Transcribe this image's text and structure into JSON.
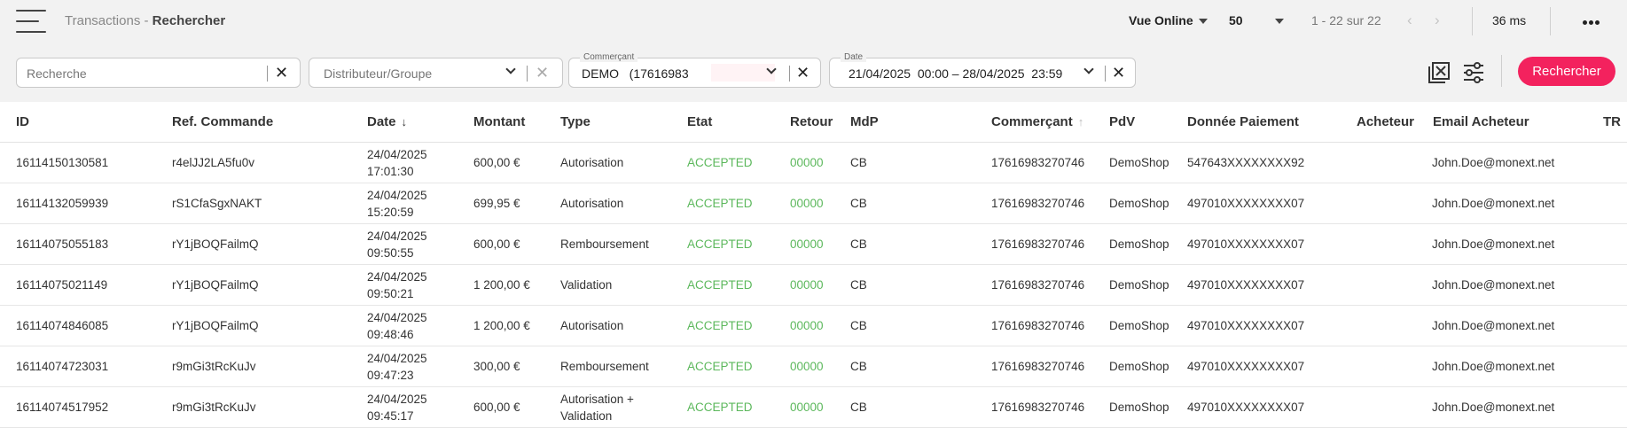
{
  "header": {
    "title_prefix": "Transactions",
    "title_separator": " - ",
    "title_page": "Rechercher",
    "view_label": "Vue Online",
    "page_size": "50",
    "pagination": "1 - 22 sur 22",
    "timing": "36 ms"
  },
  "filters": {
    "search_placeholder": "Recherche",
    "distributor_placeholder": "Distributeur/Groupe",
    "merchant_label": "Commerçant",
    "merchant_value": "DEMO   (17616983",
    "date_label": "Date",
    "date_value": "21/04/2025  00:00 – 28/04/2025  23:59",
    "search_button": "Rechercher"
  },
  "table": {
    "columns": [
      "ID",
      "Ref. Commande",
      "Date",
      "Montant",
      "Type",
      "Etat",
      "Retour",
      "MdP",
      "Commerçant",
      "PdV",
      "Donnée Paiement",
      "Acheteur",
      "Email Acheteur",
      "TR"
    ],
    "rows": [
      {
        "id": "16114150130581",
        "ref": "r4elJJ2LA5fu0v",
        "date": "24/04/2025",
        "time": "17:01:30",
        "amount": "600,00 €",
        "type": "Autorisation",
        "type2": "",
        "state": "ACCEPTED",
        "ret": "00000",
        "mdp": "CB",
        "merchant": "17616983270746",
        "pdv": "DemoShop",
        "payment": "547643XXXXXXXX92",
        "buyer": "",
        "email": "John.Doe@monext.net"
      },
      {
        "id": "16114132059939",
        "ref": "rS1CfaSgxNAKT",
        "date": "24/04/2025",
        "time": "15:20:59",
        "amount": "699,95 €",
        "type": "Autorisation",
        "type2": "",
        "state": "ACCEPTED",
        "ret": "00000",
        "mdp": "CB",
        "merchant": "17616983270746",
        "pdv": "DemoShop",
        "payment": "497010XXXXXXXX07",
        "buyer": "",
        "email": "John.Doe@monext.net"
      },
      {
        "id": "16114075055183",
        "ref": "rY1jBOQFailmQ",
        "date": "24/04/2025",
        "time": "09:50:55",
        "amount": "600,00 €",
        "type": "Remboursement",
        "type2": "",
        "state": "ACCEPTED",
        "ret": "00000",
        "mdp": "CB",
        "merchant": "17616983270746",
        "pdv": "DemoShop",
        "payment": "497010XXXXXXXX07",
        "buyer": "",
        "email": "John.Doe@monext.net"
      },
      {
        "id": "16114075021149",
        "ref": "rY1jBOQFailmQ",
        "date": "24/04/2025",
        "time": "09:50:21",
        "amount": "1 200,00 €",
        "type": "Validation",
        "type2": "",
        "state": "ACCEPTED",
        "ret": "00000",
        "mdp": "CB",
        "merchant": "17616983270746",
        "pdv": "DemoShop",
        "payment": "497010XXXXXXXX07",
        "buyer": "",
        "email": "John.Doe@monext.net"
      },
      {
        "id": "16114074846085",
        "ref": "rY1jBOQFailmQ",
        "date": "24/04/2025",
        "time": "09:48:46",
        "amount": "1 200,00 €",
        "type": "Autorisation",
        "type2": "",
        "state": "ACCEPTED",
        "ret": "00000",
        "mdp": "CB",
        "merchant": "17616983270746",
        "pdv": "DemoShop",
        "payment": "497010XXXXXXXX07",
        "buyer": "",
        "email": "John.Doe@monext.net"
      },
      {
        "id": "16114074723031",
        "ref": "r9mGi3tRcKuJv",
        "date": "24/04/2025",
        "time": "09:47:23",
        "amount": "300,00 €",
        "type": "Remboursement",
        "type2": "",
        "state": "ACCEPTED",
        "ret": "00000",
        "mdp": "CB",
        "merchant": "17616983270746",
        "pdv": "DemoShop",
        "payment": "497010XXXXXXXX07",
        "buyer": "",
        "email": "John.Doe@monext.net"
      },
      {
        "id": "16114074517952",
        "ref": "r9mGi3tRcKuJv",
        "date": "24/04/2025",
        "time": "09:45:17",
        "amount": "600,00 €",
        "type": "Autorisation +",
        "type2": "Validation",
        "state": "ACCEPTED",
        "ret": "00000",
        "mdp": "CB",
        "merchant": "17616983270746",
        "pdv": "DemoShop",
        "payment": "497010XXXXXXXX07",
        "buyer": "",
        "email": "John.Doe@monext.net"
      }
    ]
  },
  "colors": {
    "accent": "#f3225e",
    "accepted": "#5cb85c",
    "bar_background": "#f2f2f2"
  },
  "icons": {
    "menu": "hamburger-icon",
    "clear_filters": "clear-filters-icon",
    "settings": "sliders-icon",
    "more": "more-dots-icon"
  }
}
